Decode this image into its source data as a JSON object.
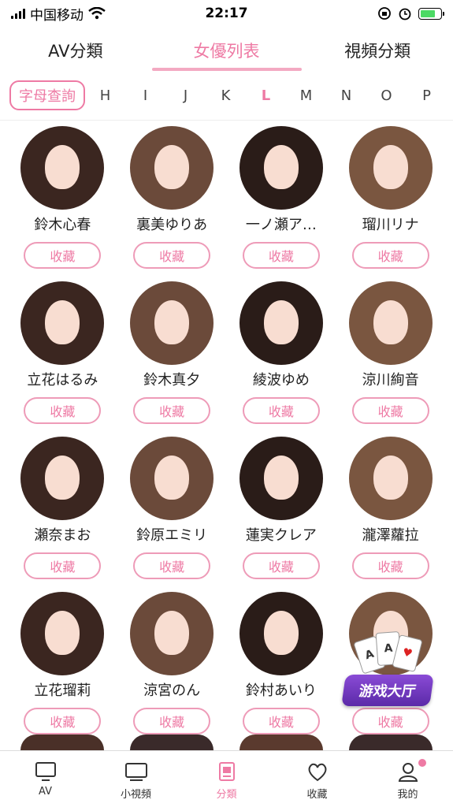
{
  "status": {
    "carrier": "中国移动",
    "time": "22:17",
    "battery_level": 0.75
  },
  "tabs": [
    {
      "label": "AV分類",
      "active": false
    },
    {
      "label": "女優列表",
      "active": true
    },
    {
      "label": "視頻分類",
      "active": false
    }
  ],
  "letter_bar": {
    "query_label": "字母查詢",
    "letters": [
      "H",
      "I",
      "J",
      "K",
      "L",
      "M",
      "N",
      "O",
      "P"
    ],
    "active_letter": "L"
  },
  "actresses": [
    {
      "name": "鈴木心春"
    },
    {
      "name": "裏美ゆりあ"
    },
    {
      "name": "一ノ瀬ア…"
    },
    {
      "name": "瑠川リナ"
    },
    {
      "name": "立花はるみ"
    },
    {
      "name": "鈴木真夕"
    },
    {
      "name": "綾波ゆめ"
    },
    {
      "name": "涼川絢音"
    },
    {
      "name": "瀬奈まお"
    },
    {
      "name": "鈴原エミリ"
    },
    {
      "name": "蓮実クレア"
    },
    {
      "name": "瀧澤蘿拉"
    },
    {
      "name": "立花瑠莉"
    },
    {
      "name": "涼宮のん"
    },
    {
      "name": "鈴村あいり"
    },
    {
      "name": ""
    }
  ],
  "fav_label": "收藏",
  "game_badge": {
    "label": "游戏大厅"
  },
  "bottom_nav": [
    {
      "label": "AV",
      "icon": "tv-icon",
      "active": false
    },
    {
      "label": "小視頻",
      "icon": "monitor-icon",
      "active": false
    },
    {
      "label": "分類",
      "icon": "category-icon",
      "active": true
    },
    {
      "label": "收藏",
      "icon": "heart-icon",
      "active": false
    },
    {
      "label": "我的",
      "icon": "user-icon",
      "active": false,
      "badge": true
    }
  ],
  "colors": {
    "accent": "#ee7aa4"
  }
}
